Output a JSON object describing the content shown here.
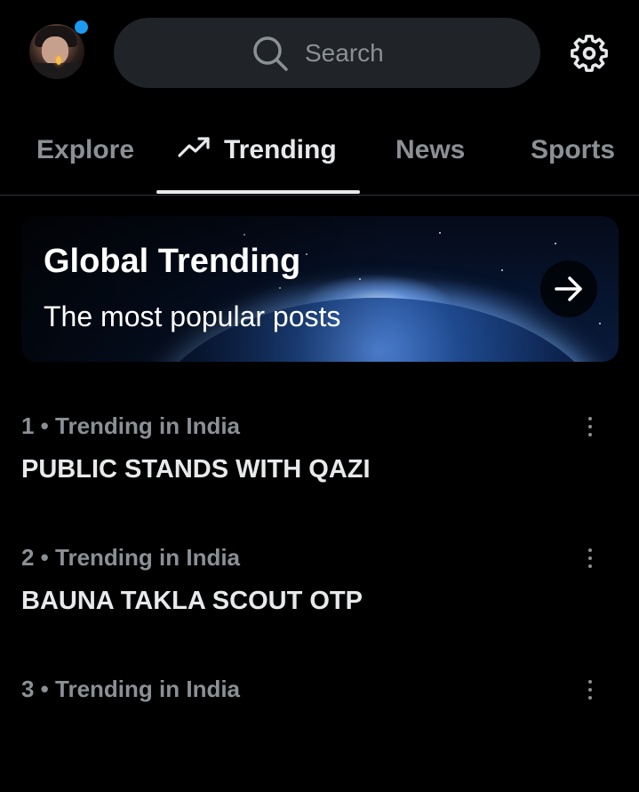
{
  "header": {
    "search_placeholder": "Search",
    "icons": [
      "avatar",
      "notification-dot",
      "search-icon",
      "gear-icon"
    ],
    "accent_color": "#1d9bf0"
  },
  "tabs": [
    {
      "label": "Explore",
      "active": false
    },
    {
      "label": "Trending",
      "active": true,
      "icon": "trending-icon"
    },
    {
      "label": "News",
      "active": false
    },
    {
      "label": "Sports",
      "active": false
    }
  ],
  "banner": {
    "title": "Global Trending",
    "subtitle": "The most popular posts",
    "icon": "arrow-right-icon"
  },
  "trends": [
    {
      "rank": "1",
      "context": "Trending in India",
      "meta": "1 • Trending in India",
      "title": "PUBLIC STANDS WITH QAZI"
    },
    {
      "rank": "2",
      "context": "Trending in India",
      "meta": "2 • Trending in India",
      "title": "BAUNA TAKLA SCOUT OTP"
    },
    {
      "rank": "3",
      "context": "Trending in India",
      "meta": "3 • Trending in India",
      "title": ""
    }
  ]
}
